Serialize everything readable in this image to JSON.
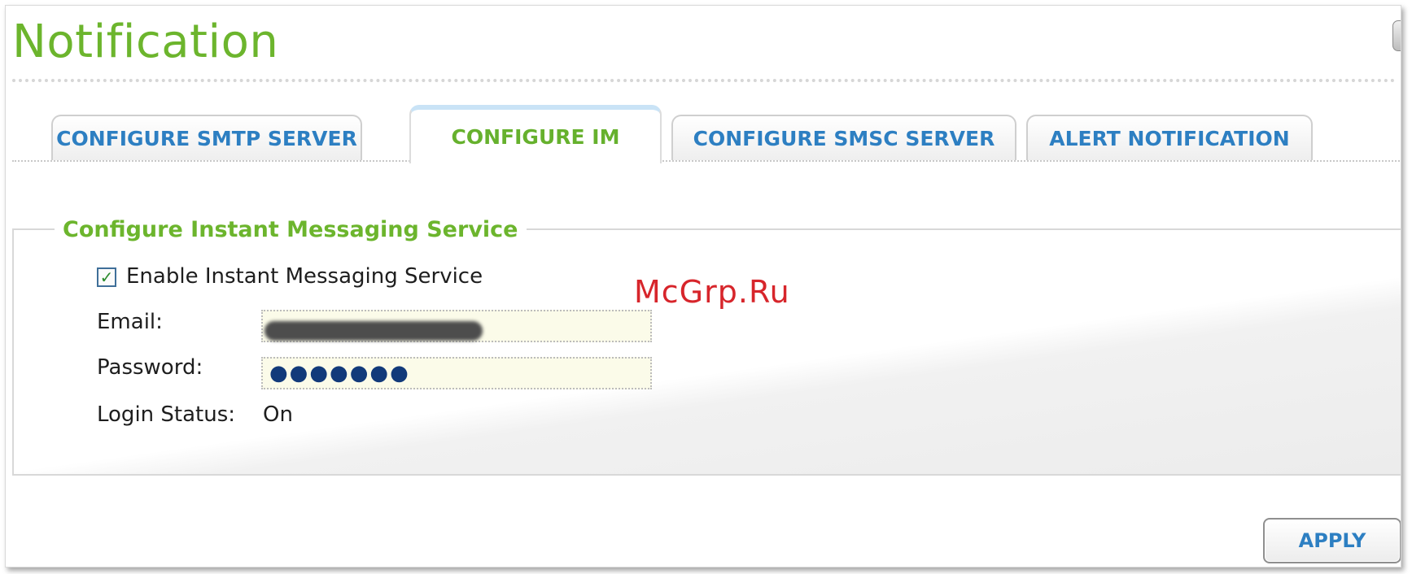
{
  "page": {
    "title": "Notification"
  },
  "tabs": [
    {
      "label": "CONFIGURE SMTP SERVER",
      "active": false
    },
    {
      "label": "CONFIGURE IM",
      "active": true
    },
    {
      "label": "CONFIGURE SMSC SERVER",
      "active": false
    },
    {
      "label": "ALERT NOTIFICATION",
      "active": false
    }
  ],
  "im_section": {
    "legend": "Configure Instant Messaging Service",
    "enable_checkbox": {
      "label": "Enable Instant Messaging Service",
      "checked": true
    },
    "email": {
      "label": "Email:",
      "value": ""
    },
    "password": {
      "label": "Password:",
      "value": "●●●●●●●"
    },
    "login_status": {
      "label": "Login Status:",
      "value": "On"
    }
  },
  "actions": {
    "apply_label": "APPLY"
  },
  "watermark": "McGrp.Ru",
  "colors": {
    "title_green": "#6cb52d",
    "tab_blue": "#2d7fc2",
    "field_bg": "#fbfbe9"
  }
}
